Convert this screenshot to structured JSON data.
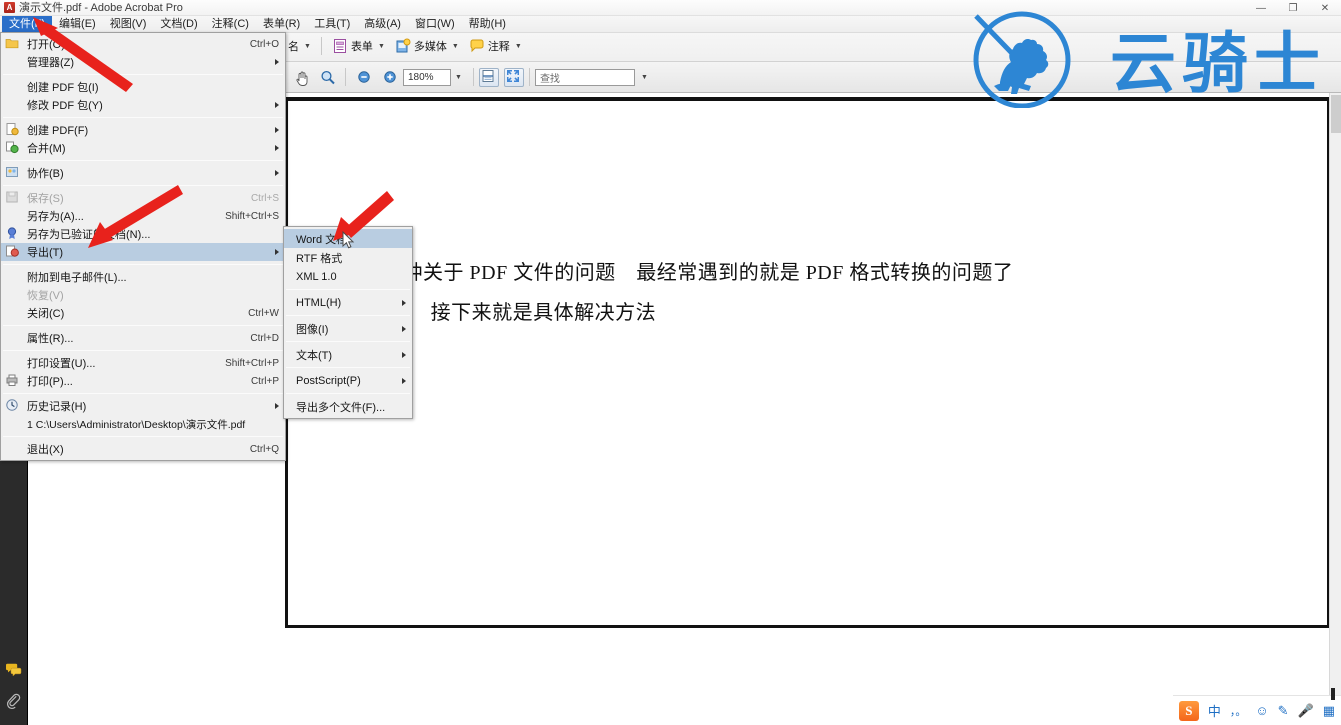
{
  "window": {
    "title": "演示文件.pdf - Adobe Acrobat Pro",
    "app_icon": "acrobat-icon",
    "controls": {
      "minimize": "—",
      "maximize": "❐",
      "close": "✕"
    }
  },
  "menubar": {
    "items": [
      {
        "label": "文件(F)",
        "active": true
      },
      {
        "label": "编辑(E)",
        "active": false
      },
      {
        "label": "视图(V)",
        "active": false
      },
      {
        "label": "文档(D)",
        "active": false
      },
      {
        "label": "注释(C)",
        "active": false
      },
      {
        "label": "表单(R)",
        "active": false
      },
      {
        "label": "工具(T)",
        "active": false
      },
      {
        "label": "高级(A)",
        "active": false
      },
      {
        "label": "窗口(W)",
        "active": false
      },
      {
        "label": "帮助(H)",
        "active": false
      }
    ]
  },
  "toolbar": {
    "row1": [
      {
        "label": "名",
        "icon": "signature-icon"
      },
      {
        "label": "表单",
        "icon": "form-icon"
      },
      {
        "label": "多媒体",
        "icon": "multimedia-icon"
      },
      {
        "label": "注释",
        "icon": "comment-icon"
      }
    ],
    "row2": {
      "hand_tool": "hand-icon",
      "marquee_zoom": "marquee-zoom-icon",
      "zoom_out": "zoom-out-icon",
      "zoom_in": "zoom-in-icon",
      "zoom_value": "180%",
      "fit_page": "fit-page-icon",
      "fit_width": "fit-width-icon",
      "find_placeholder": "查找"
    }
  },
  "file_menu": {
    "items": [
      {
        "label": "打开(O)...",
        "accel": "Ctrl+O",
        "icon": "open-folder-icon",
        "arrow": false,
        "disabled": false,
        "selected": false,
        "sep_after": false
      },
      {
        "label": "管理器(Z)",
        "accel": "",
        "icon": "",
        "arrow": true,
        "disabled": false,
        "selected": false,
        "sep_after": true
      },
      {
        "label": "创建 PDF 包(I)",
        "accel": "",
        "icon": "",
        "arrow": false,
        "disabled": false,
        "selected": false,
        "sep_after": false
      },
      {
        "label": "修改 PDF 包(Y)",
        "accel": "",
        "icon": "",
        "arrow": true,
        "disabled": false,
        "selected": false,
        "sep_after": true
      },
      {
        "label": "创建 PDF(F)",
        "accel": "",
        "icon": "create-pdf-icon",
        "arrow": true,
        "disabled": false,
        "selected": false,
        "sep_after": false
      },
      {
        "label": "合并(M)",
        "accel": "",
        "icon": "merge-icon",
        "arrow": true,
        "disabled": false,
        "selected": false,
        "sep_after": true
      },
      {
        "label": "协作(B)",
        "accel": "",
        "icon": "collaborate-icon",
        "arrow": true,
        "disabled": false,
        "selected": false,
        "sep_after": true
      },
      {
        "label": "保存(S)",
        "accel": "Ctrl+S",
        "icon": "save-icon",
        "arrow": false,
        "disabled": true,
        "selected": false,
        "sep_after": false
      },
      {
        "label": "另存为(A)...",
        "accel": "Shift+Ctrl+S",
        "icon": "",
        "arrow": false,
        "disabled": false,
        "selected": false,
        "sep_after": false
      },
      {
        "label": "另存为已验证的文档(N)...",
        "accel": "",
        "icon": "certify-icon",
        "arrow": false,
        "disabled": false,
        "selected": false,
        "sep_after": false
      },
      {
        "label": "导出(T)",
        "accel": "",
        "icon": "export-icon",
        "arrow": true,
        "disabled": false,
        "selected": true,
        "sep_after": true
      },
      {
        "label": "附加到电子邮件(L)...",
        "accel": "",
        "icon": "",
        "arrow": false,
        "disabled": false,
        "selected": false,
        "sep_after": false
      },
      {
        "label": "恢复(V)",
        "accel": "",
        "icon": "",
        "arrow": false,
        "disabled": true,
        "selected": false,
        "sep_after": false
      },
      {
        "label": "关闭(C)",
        "accel": "Ctrl+W",
        "icon": "",
        "arrow": false,
        "disabled": false,
        "selected": false,
        "sep_after": true
      },
      {
        "label": "属性(R)...",
        "accel": "Ctrl+D",
        "icon": "",
        "arrow": false,
        "disabled": false,
        "selected": false,
        "sep_after": true
      },
      {
        "label": "打印设置(U)...",
        "accel": "Shift+Ctrl+P",
        "icon": "",
        "arrow": false,
        "disabled": false,
        "selected": false,
        "sep_after": false
      },
      {
        "label": "打印(P)...",
        "accel": "Ctrl+P",
        "icon": "print-icon",
        "arrow": false,
        "disabled": false,
        "selected": false,
        "sep_after": true
      },
      {
        "label": "历史记录(H)",
        "accel": "",
        "icon": "history-icon",
        "arrow": true,
        "disabled": false,
        "selected": false,
        "sep_after": false
      },
      {
        "label": "1 C:\\Users\\Administrator\\Desktop\\演示文件.pdf",
        "accel": "",
        "icon": "",
        "arrow": false,
        "disabled": false,
        "selected": false,
        "sep_after": true
      },
      {
        "label": "退出(X)",
        "accel": "Ctrl+Q",
        "icon": "",
        "arrow": false,
        "disabled": false,
        "selected": false,
        "sep_after": false
      }
    ]
  },
  "export_menu": {
    "items": [
      {
        "label": "Word 文档",
        "arrow": false,
        "selected": true,
        "sep_after": true
      },
      {
        "label": "RTF 格式",
        "arrow": false,
        "selected": false,
        "sep_after": false
      },
      {
        "label": "XML 1.0",
        "arrow": false,
        "selected": false,
        "sep_after": true
      },
      {
        "label": "HTML(H)",
        "arrow": true,
        "selected": false,
        "sep_after": true
      },
      {
        "label": "图像(I)",
        "arrow": true,
        "selected": false,
        "sep_after": true
      },
      {
        "label": "文本(T)",
        "arrow": true,
        "selected": false,
        "sep_after": true
      },
      {
        "label": "PostScript(P)",
        "arrow": true,
        "selected": false,
        "sep_after": true
      },
      {
        "label": "导出多个文件(F)...",
        "arrow": false,
        "selected": false,
        "sep_after": false
      }
    ]
  },
  "document": {
    "lines": [
      "各种关于 PDF 文件的问题　最经常遇到的就是 PDF 格式转换的问题了",
      "ord　接下来就是具体解决方法"
    ]
  },
  "watermark": {
    "text": "云骑士",
    "color": "#2d86d4",
    "emblem": "horseman-circle-icon"
  },
  "navpane": {
    "icons": [
      "comments-icon",
      "attachment-icon"
    ]
  },
  "ime": {
    "brand": "S",
    "items": [
      "中",
      "，。",
      "☺",
      "✎",
      "🎤",
      "▦"
    ]
  },
  "annotations": {
    "arrow_color": "#e8221c",
    "arrows": [
      "arrow-to-file-menu",
      "arrow-to-export-item",
      "arrow-to-word-item"
    ]
  },
  "colors": {
    "menu_highlight": "#b9cde1",
    "menubar_active": "#2a6ec9",
    "navpane": "#2b2b2b"
  }
}
